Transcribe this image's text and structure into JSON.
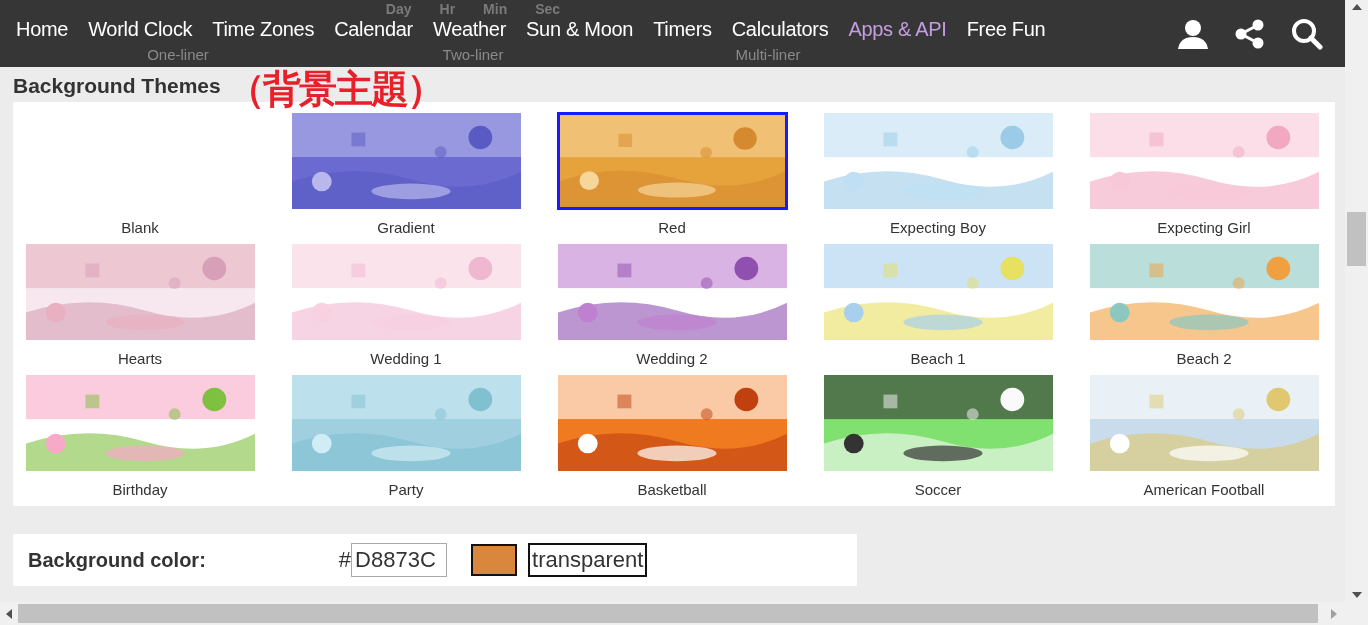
{
  "nav": {
    "items": [
      {
        "label": "Home",
        "selected": false
      },
      {
        "label": "World Clock",
        "selected": false
      },
      {
        "label": "Time Zones",
        "selected": false
      },
      {
        "label": "Calendar",
        "selected": false
      },
      {
        "label": "Weather",
        "selected": false
      },
      {
        "label": "Sun & Moon",
        "selected": false
      },
      {
        "label": "Timers",
        "selected": false
      },
      {
        "label": "Calculators",
        "selected": false
      },
      {
        "label": "Apps & API",
        "selected": true
      },
      {
        "label": "Free Fun",
        "selected": false
      }
    ]
  },
  "styles": [
    {
      "label": "One-liner"
    },
    {
      "label": "Two-liner",
      "digits": [
        "Day",
        "Hr",
        "Min",
        "Sec"
      ]
    },
    {
      "label": "Multi-liner"
    }
  ],
  "heading": "Background Themes",
  "annotation": "（背景主題）",
  "themes": [
    {
      "label": "Blank",
      "selected": false,
      "kind": "blank"
    },
    {
      "label": "Gradient",
      "selected": false
    },
    {
      "label": "Red",
      "selected": true
    },
    {
      "label": "Expecting Boy",
      "selected": false
    },
    {
      "label": "Expecting Girl",
      "selected": false
    },
    {
      "label": "Hearts",
      "selected": false
    },
    {
      "label": "Wedding 1",
      "selected": false
    },
    {
      "label": "Wedding 2",
      "selected": false
    },
    {
      "label": "Beach 1",
      "selected": false
    },
    {
      "label": "Beach 2",
      "selected": false
    },
    {
      "label": "Birthday",
      "selected": false
    },
    {
      "label": "Party",
      "selected": false
    },
    {
      "label": "Basketball",
      "selected": false
    },
    {
      "label": "Soccer",
      "selected": false
    },
    {
      "label": "American Football",
      "selected": false
    }
  ],
  "background_color": {
    "label": "Background color:",
    "hash": "#",
    "value": "D8873C",
    "color": "#d8873c",
    "transparent": "transparent"
  }
}
